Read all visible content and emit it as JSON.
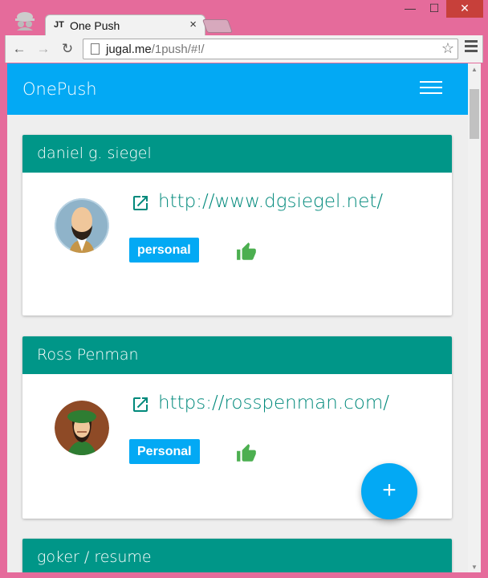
{
  "browser": {
    "tab_favicon": "JT",
    "tab_title": "One Push",
    "tab_close": "×",
    "url_host": "jugal.me",
    "url_path": "/1push/#!/",
    "window_minimize": "—",
    "window_maximize": "☐",
    "window_close": "✕",
    "back_icon": "←",
    "forward_icon": "→",
    "reload_icon": "↻",
    "star_icon": "☆"
  },
  "app": {
    "title": "OnePush",
    "accent_color": "#03a9f4",
    "card_header_color": "#009688",
    "fab_label": "+"
  },
  "cards": [
    {
      "name": "daniel g. siegel",
      "url": "http://www.dgsiegel.net/",
      "tag": "personal"
    },
    {
      "name": "Ross Penman",
      "url": "https://rosspenman.com/",
      "tag": "Personal"
    },
    {
      "name": "goker / resume"
    }
  ]
}
